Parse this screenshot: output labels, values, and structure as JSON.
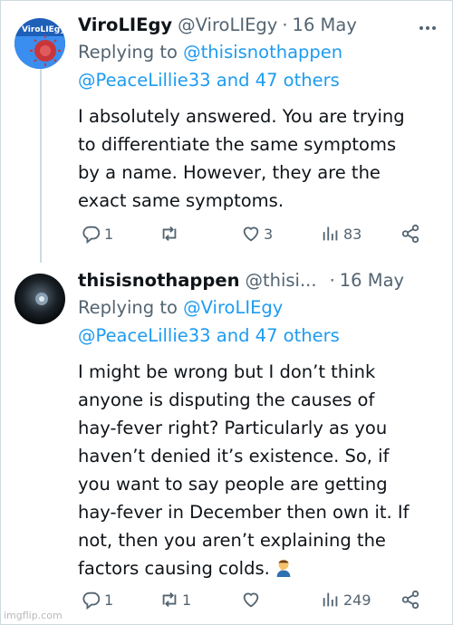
{
  "tweets": [
    {
      "display_name": "ViroLIEgy",
      "handle": "@ViroLIEgy",
      "separator": "·",
      "date": "16 May",
      "avatar_text": "ViroLIEgy",
      "replying_prefix": "Replying to",
      "replying_to": "@thisisnothappen",
      "replying_others": "@PeaceLillie33 and 47 others",
      "text_lines": [
        "I absolutely answered. You are trying",
        "to differentiate the same symptoms",
        "by a name. However, they are the",
        "exact same symptoms."
      ],
      "replies": "1",
      "retweets": "",
      "likes": "3",
      "views": "83"
    },
    {
      "display_name": "thisisnothappen",
      "handle": "@thisi...",
      "separator": "·",
      "date": "16 May",
      "replying_prefix": "Replying to",
      "replying_to": "@ViroLIEgy",
      "replying_others": "@PeaceLillie33 and 47 others",
      "text_lines": [
        "I might be wrong but I don’t think",
        "anyone is disputing the causes of",
        "hay-fever right? Particularly as you",
        "haven’t denied it’s existence. So, if",
        "you want to say people are getting",
        "hay-fever in December then own it. If",
        "not, then you aren’t explaining the",
        "factors causing colds."
      ],
      "emoji_icon": "person-facepalming-emoji",
      "replies": "1",
      "retweets": "1",
      "likes": "",
      "views": "249"
    }
  ],
  "more_icon": "more-dots-icon",
  "watermark": "imgflip.com",
  "colors": {
    "link": "#1d9bf0",
    "muted": "#536471",
    "text": "#0f1419"
  }
}
